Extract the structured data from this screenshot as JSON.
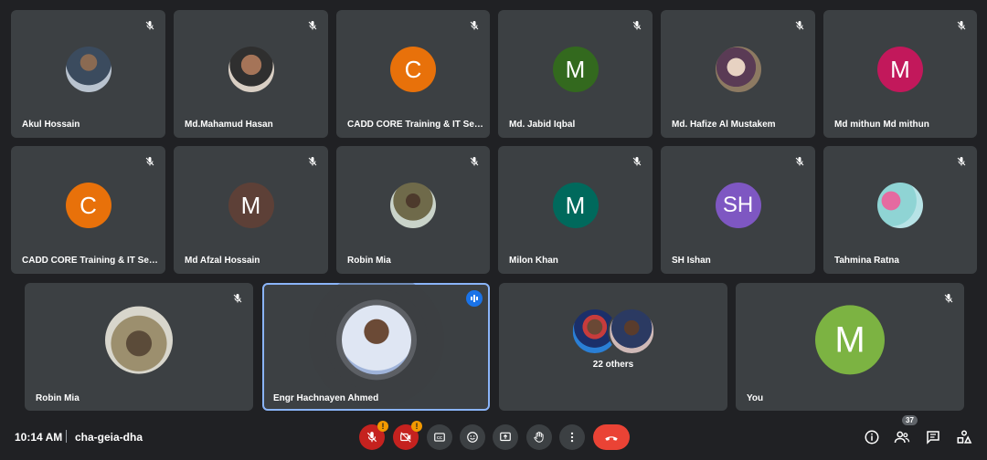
{
  "tiles": [
    {
      "name": "Akul Hossain"
    },
    {
      "name": "Md.Mahamud Hasan"
    },
    {
      "name": "CADD CORE Training & IT Ser...",
      "letter": "C",
      "color": "#e8710a"
    },
    {
      "name": "Md. Jabid Iqbal",
      "letter": "M",
      "color": "#33691e"
    },
    {
      "name": "Md. Hafize Al Mustakem"
    },
    {
      "name": "Md mithun Md mithun",
      "letter": "M",
      "color": "#c2185b"
    },
    {
      "name": "CADD CORE Training & IT Ser...",
      "letter": "C",
      "color": "#e8710a"
    },
    {
      "name": "Md Afzal Hossain",
      "letter": "M",
      "color": "#5d4037"
    },
    {
      "name": "Robin Mia"
    },
    {
      "name": "Milon Khan",
      "letter": "M",
      "color": "#00695c"
    },
    {
      "name": "SH Ishan",
      "letter": "SH",
      "color": "#7e57c2"
    },
    {
      "name": "Tahmina Ratna"
    },
    {
      "name": "Robin Mia"
    },
    {
      "name": "Engr Hachnayen Ahmed"
    },
    {
      "name": "22 others"
    },
    {
      "name": "You",
      "letter": "M",
      "color": "#7cb342"
    }
  ],
  "bar": {
    "time": "10:14 AM",
    "meeting_code": "cha-geia-dha",
    "participant_count": "37",
    "mic_alert": "!",
    "cam_alert": "!"
  },
  "icons": {
    "mute": "mic-off-icon",
    "speaking": "audio-level-icon",
    "captions": "captions-icon",
    "emoji": "emoji-icon",
    "present": "present-screen-icon",
    "hand": "raise-hand-icon",
    "more": "more-options-icon",
    "hangup": "hang-up-icon",
    "info": "info-icon",
    "people": "people-icon",
    "chat": "chat-icon",
    "activities": "activities-icon"
  }
}
